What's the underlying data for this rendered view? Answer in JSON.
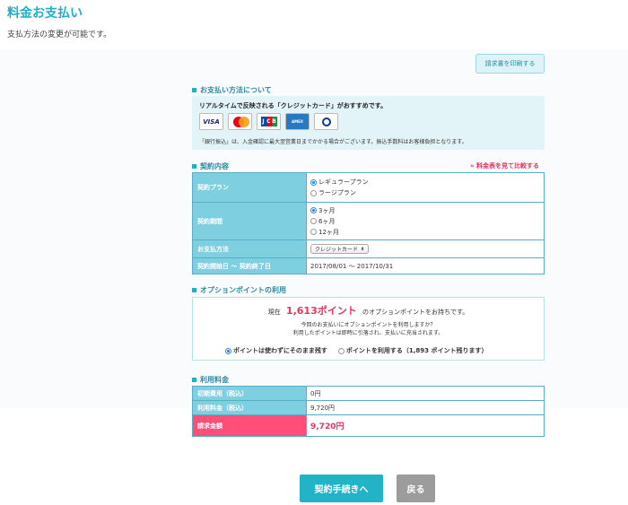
{
  "header": {
    "title": "料金お支払い",
    "description": "支払方法の変更が可能です。"
  },
  "print_button": "請求書を印刷する",
  "payment_section": {
    "heading": "お支払い方法について",
    "recommend": "リアルタイムで反映される「クレジットカード」がおすすめです。",
    "cards": [
      "VISA",
      "MasterCard",
      "JCB",
      "AMERICAN EXPRESS",
      "Diners Club"
    ],
    "note": "「銀行振込」は、入金確認に最大翌営業日までかかる場合がございます。振込手数料はお客様負担となります。"
  },
  "contract_section": {
    "heading": "契約内容",
    "compare_link": "» 料金表を見て比較する",
    "plan_label": "契約プラン",
    "plan_options": [
      "レギュラープラン",
      "ラージプラン"
    ],
    "plan_selected": 0,
    "period_label": "契約期間",
    "period_options": [
      "3ヶ月",
      "6ヶ月",
      "12ヶ月"
    ],
    "period_selected": 0,
    "method_label": "お支払方法",
    "method_value": "クレジットカード",
    "dates_label": "契約開始日 〜 契約終了日",
    "dates_value": "2017/08/01 〜 2017/10/31"
  },
  "point_section": {
    "heading": "オプションポイントの利用",
    "prefix": "現在",
    "points": "1,613ポイント",
    "suffix": "のオプションポイントをお持ちです。",
    "question1": "今回のお支払いにオプションポイントを利用しますか？",
    "question2": "利用したポイントは即時に引落され、支払いに充当されます。",
    "option_keep": "ポイントは使わずにそのまま残す",
    "option_use": "ポイントを利用する（1,893 ポイント残ります）",
    "selected": "keep"
  },
  "fee_section": {
    "heading": "利用料金",
    "rows": [
      {
        "label": "初期費用（税込）",
        "value": "0円"
      },
      {
        "label": "利用料金（税込）",
        "value": "9,720円"
      }
    ],
    "total_label": "請求金額",
    "total_value": "9,720円"
  },
  "actions": {
    "proceed": "契約手続きへ",
    "back": "戻る"
  },
  "colors": {
    "accent": "#1fb0c9",
    "label_bg": "#7ecfe0",
    "highlight": "#e8335c",
    "total_bg": "#ff4f79"
  }
}
